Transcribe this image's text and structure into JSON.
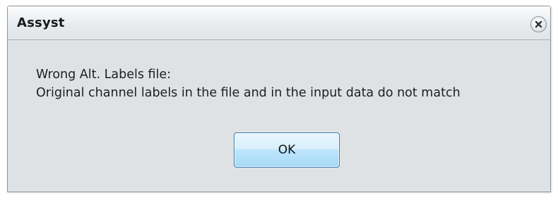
{
  "dialog": {
    "title": "Assyst",
    "close_icon": "close-icon",
    "message_lines": [
      "Wrong Alt. Labels file:",
      "Original channel labels in the file and in the input data do not match"
    ],
    "ok_label": "OK"
  },
  "colors": {
    "dialog_background": "#dfe2e5",
    "ok_button_accent": "#bee6fd",
    "ok_button_border": "#3c7fb1"
  }
}
